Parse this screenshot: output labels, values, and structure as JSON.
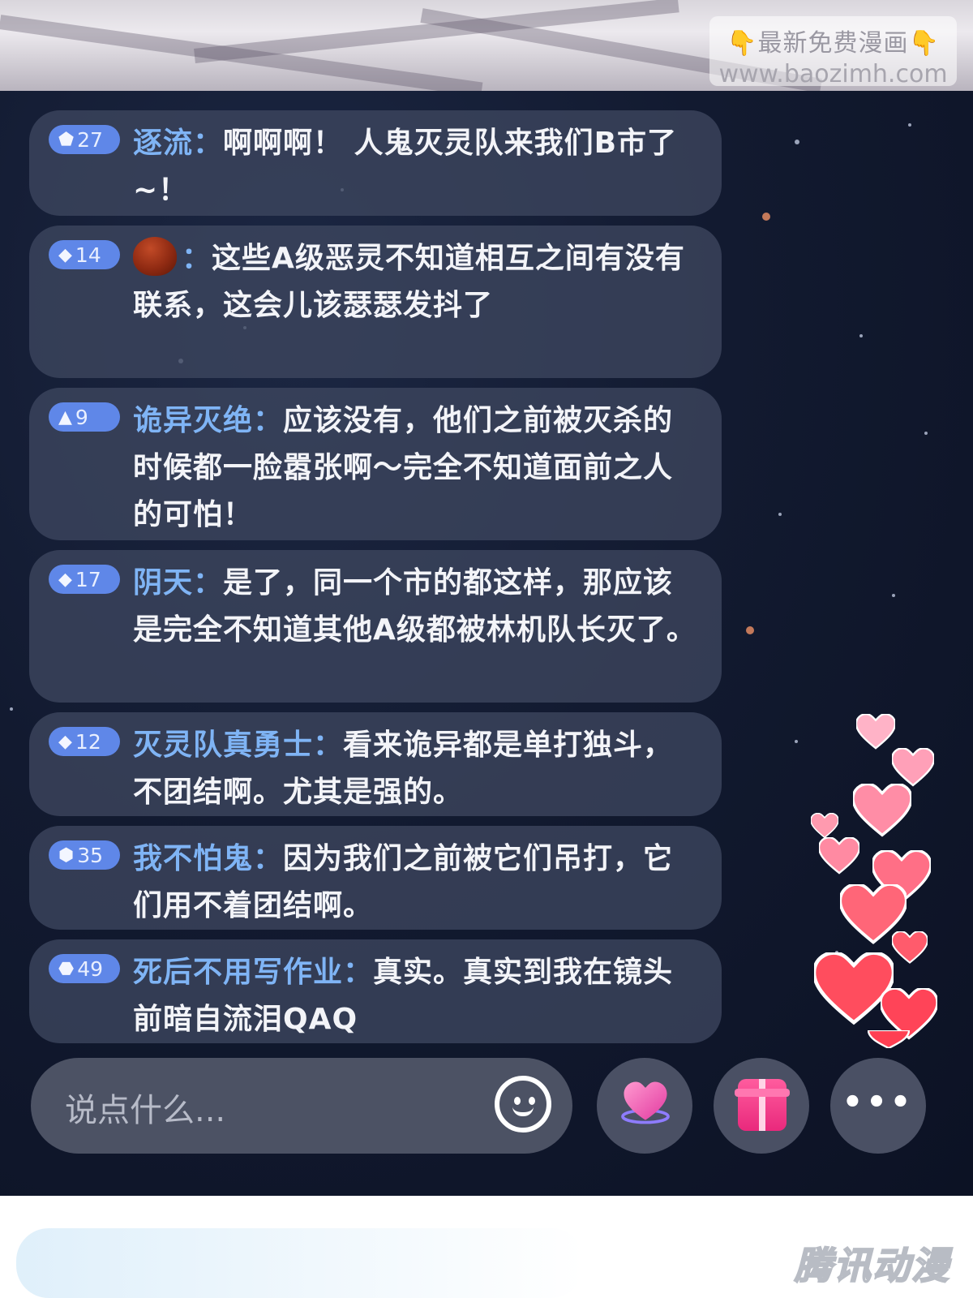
{
  "watermark": {
    "line1": "最新免费漫画",
    "line2": "www.baozimh.com",
    "hand_icon": "👇"
  },
  "comments": [
    {
      "badge_icon": "pentagon",
      "badge_glyph": "⬟",
      "level": "27",
      "name": "逐流",
      "colon": "：",
      "text": "啊啊啊！ 人鬼灭灵队来我们B市了~！"
    },
    {
      "badge_icon": "diamond",
      "badge_glyph": "◆",
      "level": "14",
      "name": "",
      "avatar_icon": "chestnut-icon",
      "colon": "：",
      "text": "这些A级恶灵不知道相互之间有没有联系，这会儿该瑟瑟发抖了"
    },
    {
      "badge_icon": "triangle",
      "badge_glyph": "▲",
      "level": "9",
      "name": "诡异灭绝",
      "colon": "：",
      "text": "应该没有，他们之前被灭杀的时候都一脸嚣张啊～完全不知道面前之人的可怕！"
    },
    {
      "badge_icon": "diamond",
      "badge_glyph": "◆",
      "level": "17",
      "name": "阴天",
      "colon": "：",
      "text": "是了，同一个市的都这样，那应该是完全不知道其他A级都被林机队长灭了。"
    },
    {
      "badge_icon": "diamond",
      "badge_glyph": "◆",
      "level": "12",
      "name": "灭灵队真勇士",
      "colon": "：",
      "text": "看来诡异都是单打独斗，不团结啊。尤其是强的。"
    },
    {
      "badge_icon": "hexagon",
      "badge_glyph": "⬢",
      "level": "35",
      "name": "我不怕鬼",
      "colon": "：",
      "text": "因为我们之前被它们吊打，它们用不着团结啊。"
    },
    {
      "badge_icon": "octagon",
      "badge_glyph": "⬣",
      "level": "49",
      "name": "死后不用写作业",
      "colon": "：",
      "text": "真实。真实到我在镜头前暗自流泪QAQ"
    }
  ],
  "input": {
    "placeholder": "说点什么..."
  },
  "buttons": {
    "emoji_icon": "smiley-icon",
    "like_icon": "heart-icon",
    "gift_icon": "gift-icon",
    "more_icon": "more-icon",
    "more_label": "•••"
  },
  "footer": {
    "logo": "腾讯动漫"
  },
  "colors": {
    "background": "#121a30",
    "bubble": "#3e465f",
    "badge": "#5f87e8",
    "username": "#7fb4f5",
    "text": "#f3f4f8",
    "heart": "#ff5a66"
  }
}
